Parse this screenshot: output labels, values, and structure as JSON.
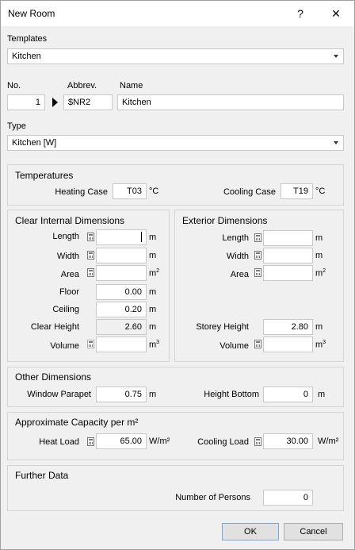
{
  "window": {
    "title": "New Room",
    "help_label": "?",
    "close_label": "✕"
  },
  "templates": {
    "label": "Templates",
    "value": "Kitchen"
  },
  "ident": {
    "no_label": "No.",
    "no_value": "1",
    "abbrev_label": "Abbrev.",
    "abbrev_value": "$NR2",
    "name_label": "Name",
    "name_value": "Kitchen"
  },
  "type": {
    "label": "Type",
    "value": "Kitchen [W]"
  },
  "temperatures": {
    "title": "Temperatures",
    "heating_label": "Heating Case",
    "heating_value": "T03",
    "heating_unit": "°C",
    "cooling_label": "Cooling Case",
    "cooling_value": "T19",
    "cooling_unit": "°C"
  },
  "clear_internal": {
    "title": "Clear Internal Dimensions",
    "length_label": "Length",
    "length_value": "",
    "length_unit": "m",
    "width_label": "Width",
    "width_value": "",
    "width_unit": "m",
    "area_label": "Area",
    "area_value": "",
    "area_unit": "m",
    "floor_label": "Floor",
    "floor_value": "0.00",
    "floor_unit": "m",
    "ceiling_label": "Ceiling",
    "ceiling_value": "0.20",
    "ceiling_unit": "m",
    "clear_height_label": "Clear Height",
    "clear_height_value": "2.60",
    "clear_height_unit": "m",
    "volume_label": "Volume",
    "volume_value": "",
    "volume_unit": "m"
  },
  "exterior": {
    "title": "Exterior Dimensions",
    "length_label": "Length",
    "length_value": "",
    "length_unit": "m",
    "width_label": "Width",
    "width_value": "",
    "width_unit": "m",
    "area_label": "Area",
    "area_value": "",
    "area_unit": "m",
    "storey_height_label": "Storey Height",
    "storey_height_value": "2.80",
    "storey_height_unit": "m",
    "volume_label": "Volume",
    "volume_value": "",
    "volume_unit": "m"
  },
  "other": {
    "title": "Other Dimensions",
    "window_parapet_label": "Window Parapet",
    "window_parapet_value": "0.75",
    "window_parapet_unit": "m",
    "height_bottom_label": "Height Bottom",
    "height_bottom_value": "0",
    "height_bottom_unit": "m"
  },
  "capacity": {
    "title": "Approximate Capacity per m²",
    "heat_label": "Heat Load",
    "heat_value": "65.00",
    "heat_unit": "W/m²",
    "cool_label": "Cooling Load",
    "cool_value": "30.00",
    "cool_unit": "W/m²"
  },
  "further": {
    "title": "Further Data",
    "persons_label": "Number of Persons",
    "persons_value": "0"
  },
  "buttons": {
    "ok": "OK",
    "cancel": "Cancel"
  },
  "icons": {
    "calculator": "calculator-icon",
    "play": "play-arrow-icon",
    "dropdown": "chevron-down-icon"
  },
  "colors": {
    "background": "#f0f0f0",
    "field": "#ffffff",
    "border": "#c8c8c8"
  }
}
